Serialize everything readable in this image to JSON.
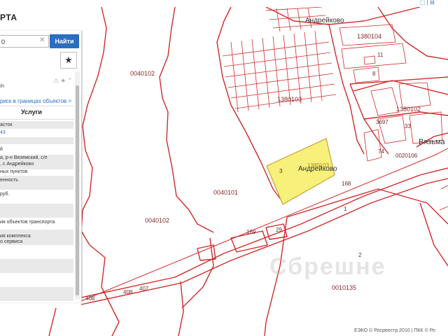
{
  "topbar": {
    "icons": "⬚ | ⊟"
  },
  "panel": {
    "title": "РТА",
    "search": {
      "value": "0",
      "find_label": "Найти"
    },
    "fav_icon": "★",
    "result_suffix": "/п",
    "tools": "⚠★⌃",
    "link_text": "риск в границах объектов >",
    "services_label": "Услуги",
    "rows": [
      {
        "text": "асток",
        "link": false
      },
      {
        "text": "43",
        "link": true
      },
      {
        "text": "й",
        "link": false
      },
      {
        "text": "а, р-н Вяземский, с/п",
        "link": false
      },
      {
        "text": ", с Андрейково",
        "link": false
      },
      {
        "text": "ных пунктов",
        "link": false
      },
      {
        "text": "енность",
        "link": false
      },
      {
        "text": "руб.",
        "link": false
      },
      {
        "text": "ия объектов транспорта",
        "link": false
      },
      {
        "text": "ия комплекса",
        "link": false
      },
      {
        "text": "о сервиса",
        "link": false
      }
    ]
  },
  "map": {
    "labels": {
      "q0040102a": "0040102",
      "q0040102b": "0040102",
      "q0040101": "0040101",
      "q1380103": "1380103",
      "q1380104": "1380104",
      "q1380102": "1380102",
      "q0020106": "0020106",
      "q0010135": "0010135",
      "plot_num": "1380103",
      "plot_small": "3",
      "andreykovo_top": "Андрейково",
      "andreykovo_plot": "Андрейково",
      "vyazma": "Вязьма",
      "n168": "168",
      "n169": "169",
      "n29": "29",
      "n408a": "408",
      "n408b": "408",
      "n407": "407",
      "n1": "1",
      "n2": "2",
      "n3697": "3697",
      "n74": "74",
      "n11": "11",
      "n33": "33",
      "n8": "8"
    },
    "watermark": "Сбрешне",
    "copyright": "ЕЭКО © Росреестр 2010 | ПКК © Ро"
  },
  "colors": {
    "boundary": "#d22a2a",
    "plot_fill": "#f7f07a",
    "button": "#2a6ebf"
  }
}
